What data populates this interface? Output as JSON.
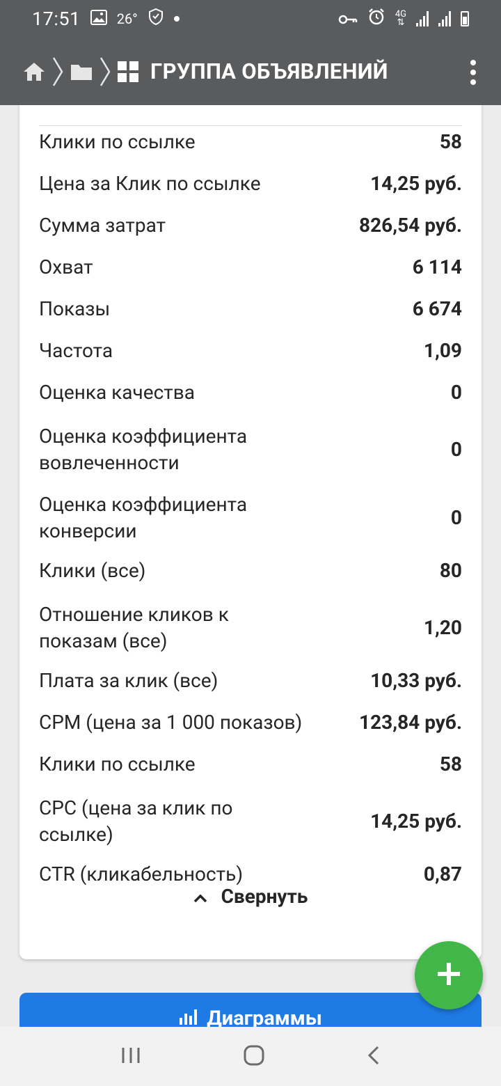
{
  "status": {
    "time": "17:51",
    "temp": "26°",
    "network": "4G"
  },
  "appbar": {
    "title": "ГРУППА ОБЪЯВЛЕНИЙ"
  },
  "stats": [
    {
      "label": "Клики по ссылке",
      "value": "58"
    },
    {
      "label": "Цена за Клик по ссылке",
      "value": "14,25 руб."
    },
    {
      "label": "Сумма затрат",
      "value": "826,54 руб."
    },
    {
      "label": "Охват",
      "value": "6 114"
    },
    {
      "label": "Показы",
      "value": "6 674"
    },
    {
      "label": "Частота",
      "value": "1,09"
    },
    {
      "label": "Оценка качества",
      "value": "0"
    },
    {
      "label": "Оценка коэффициента вовлеченности",
      "value": "0"
    },
    {
      "label": "Оценка коэффициента конверсии",
      "value": "0"
    },
    {
      "label": "Клики (все)",
      "value": "80"
    },
    {
      "label": "Отношение кликов к показам (все)",
      "value": "1,20"
    },
    {
      "label": "Плата за клик (все)",
      "value": "10,33 руб."
    },
    {
      "label": "CPM (цена за 1 000 показов)",
      "value": "123,84 руб."
    },
    {
      "label": "Клики по ссылке",
      "value": "58"
    },
    {
      "label": "CPC (цена за клик по ссылке)",
      "value": "14,25 руб."
    },
    {
      "label": "CTR (кликабельность)",
      "value": "0,87"
    }
  ],
  "collapse_label": "Свернуть",
  "charts_button_label": "Диаграммы",
  "colors": {
    "bar": "#5a5b5d",
    "primary": "#1e7be6",
    "fab": "#43b649"
  }
}
